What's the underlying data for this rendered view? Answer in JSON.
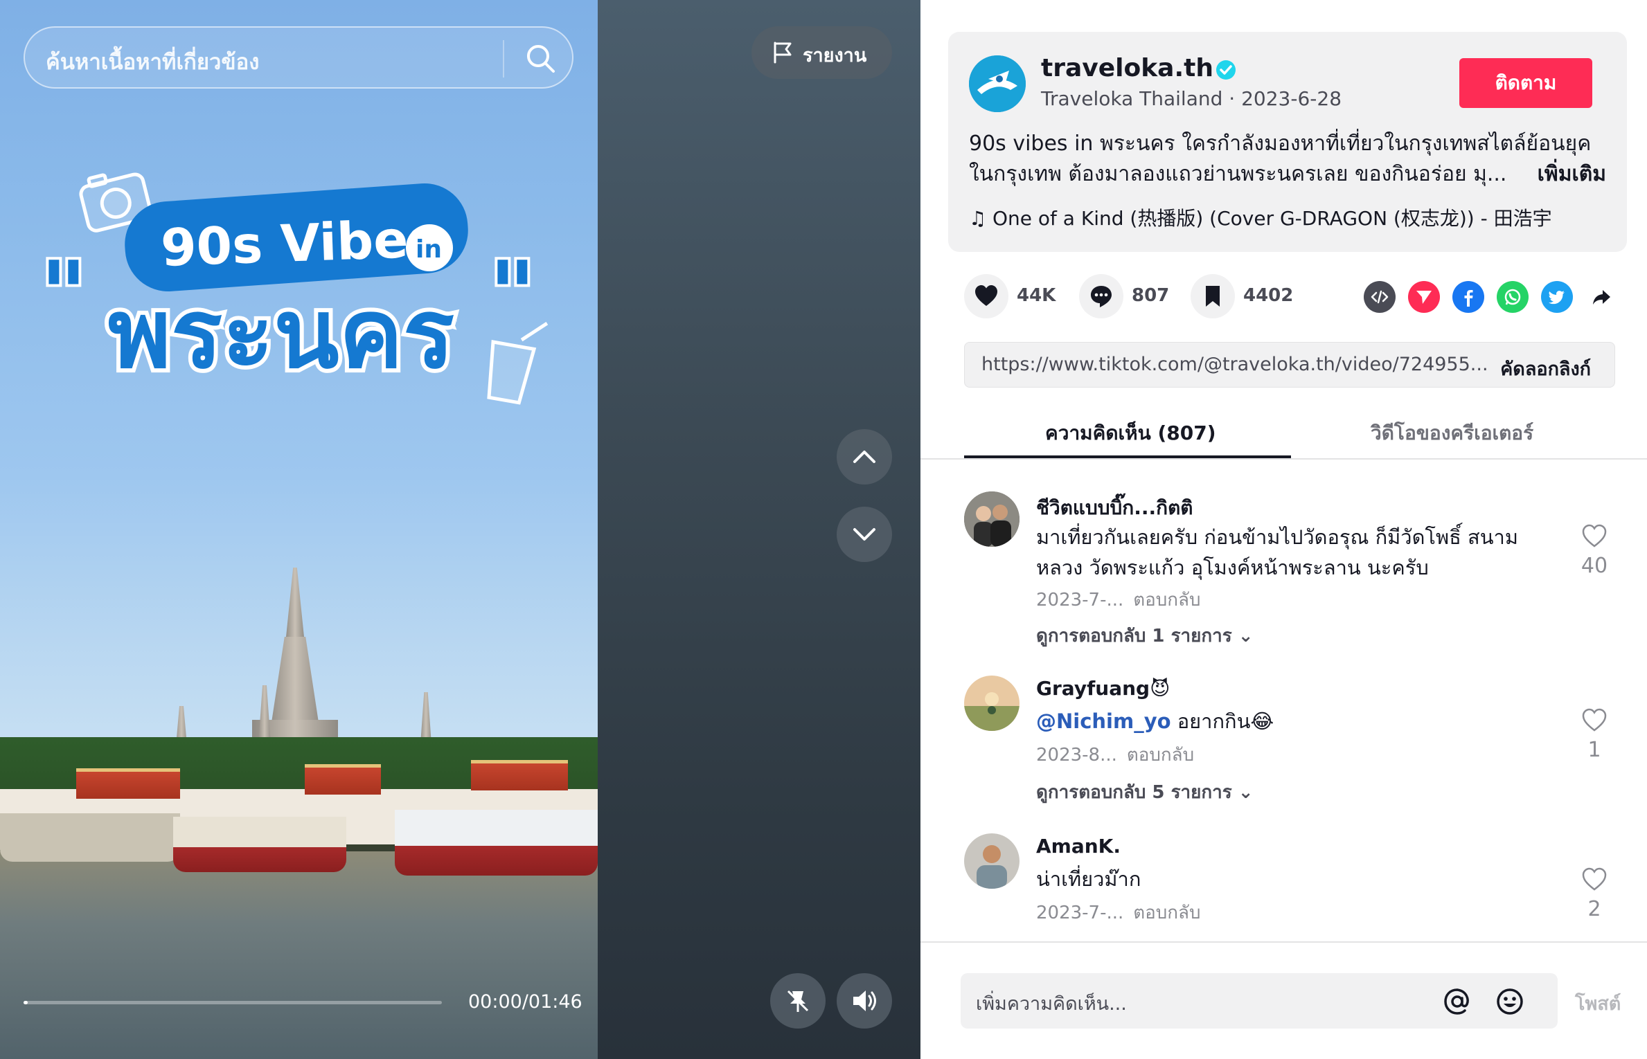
{
  "video": {
    "search_placeholder": "ค้นหาเนื้อหาที่เกี่ยวข้อง",
    "report_label": "รายงาน",
    "overlay_title_line1": "90s Vibes",
    "overlay_in": "in",
    "overlay_title_line2": "พระนคร",
    "time": "00:00/01:46",
    "progress": 0.01
  },
  "post": {
    "username": "traveloka.th",
    "display_name": "Traveloka Thailand",
    "date": "2023-6-28",
    "follow_label": "ติดตาม",
    "description": "90s vibes in พระนคร ใครกำลังมองหาที่เที่ยวในกรุงเทพสไตล์ย้อนยุค ในกรุงเทพ ต้องมาลองแถวย่านพระนครเลย ของกินอร่อย มุ...",
    "more_label": "เพิ่มเติม",
    "music": "One of a Kind (热播版)   (Cover G-DRAGON (权志龙)) - 田浩宇"
  },
  "actions": {
    "likes": "44K",
    "comments": "807",
    "saves": "4402"
  },
  "link": {
    "url": "https://www.tiktok.com/@traveloka.th/video/724955...",
    "copy_label": "คัดลอกลิงก์"
  },
  "tabs": [
    {
      "label": "ความคิดเห็น (807)"
    },
    {
      "label": "วิดีโอของครีเอเตอร์"
    }
  ],
  "comments": [
    {
      "name": "ชีวิตแบบบิ๊ก...กิตติ",
      "text": "มาเที่ยวกันเลยครับ ก่อนข้ามไปวัดอรุณ ก็มีวัดโพธิ์ สนามหลวง วัดพระแก้ว อุโมงค์หน้าพระลาน นะครับ",
      "date": "2023-7-...",
      "reply_label": "ตอบกลับ",
      "view_replies": "ดูการตอบกลับ 1 รายการ",
      "likes": "40"
    },
    {
      "name": "Grayfuang😈",
      "mention": "@Nichim_yo",
      "text": " อยากกิน😂",
      "date": "2023-8...",
      "reply_label": "ตอบกลับ",
      "view_replies": "ดูการตอบกลับ 5 รายการ",
      "likes": "1"
    },
    {
      "name": "AmanK.",
      "text": "น่าเที่ยวม๊าก",
      "date": "2023-7-...",
      "reply_label": "ตอบกลับ",
      "likes": "2"
    }
  ],
  "composer": {
    "placeholder": "เพิ่มความคิดเห็น...",
    "post_label": "โพสต์"
  },
  "colors": {
    "accent": "#fe2c55",
    "mention": "#2b5db9",
    "verified": "#20d5ec"
  }
}
